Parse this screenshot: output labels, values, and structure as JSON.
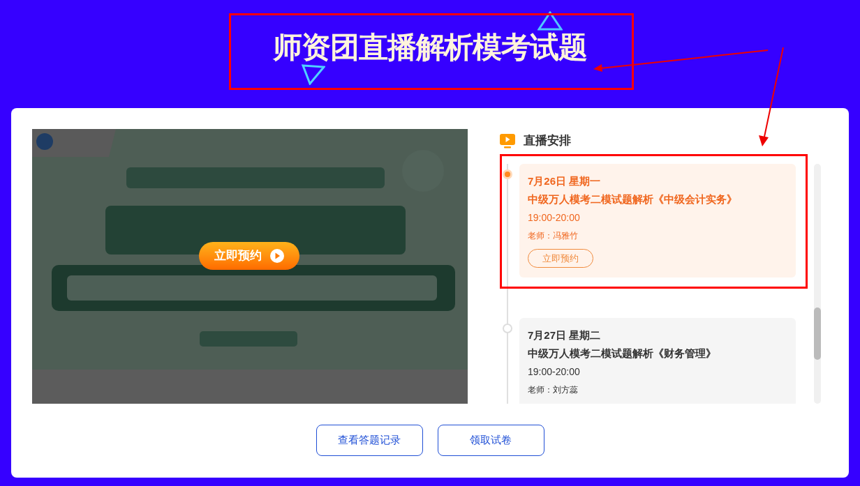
{
  "header": {
    "title": "师资团直播解析模考试题"
  },
  "video": {
    "kind": "picture",
    "overlay_button": "立即预约"
  },
  "schedule": {
    "title": "直播安排",
    "items": [
      {
        "date": "7月26日 星期一",
        "title": "中级万人模考二模试题解析《中级会计实务》",
        "time": "19:00-20:00",
        "teacher": "老师：冯雅竹",
        "button": "立即预约",
        "selected": true
      },
      {
        "date": "7月27日 星期二",
        "title": "中级万人模考二模试题解析《财务管理》",
        "time": "19:00-20:00",
        "teacher": "老师：刘方蕊",
        "selected": false
      }
    ]
  },
  "buttons": [
    "查看答题记录",
    "领取试卷"
  ]
}
